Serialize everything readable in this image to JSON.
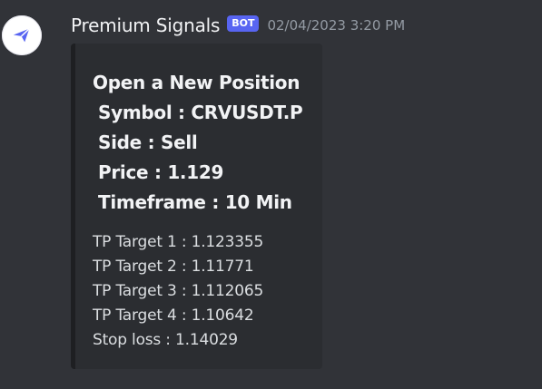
{
  "message": {
    "author": "Premium Signals",
    "badge": "BOT",
    "timestamp": "02/04/2023 3:20 PM"
  },
  "embed": {
    "heading_lines": [
      "Open a New Position",
      "Symbol : CRVUSDT.P",
      "Side : Sell",
      "Price : 1.129",
      "Timeframe : 10 Min"
    ],
    "detail_lines": [
      "TP Target 1 : 1.123355",
      "TP Target 2 : 1.11771",
      "TP Target 3 : 1.112065",
      "TP Target 4 : 1.10642",
      "Stop loss : 1.14029"
    ]
  },
  "colors": {
    "background": "#313338",
    "embed_background": "#2b2d31",
    "badge": "#5865f2",
    "avatar_icon": "#5865f2"
  },
  "icons": {
    "avatar": "paper-plane-icon"
  }
}
